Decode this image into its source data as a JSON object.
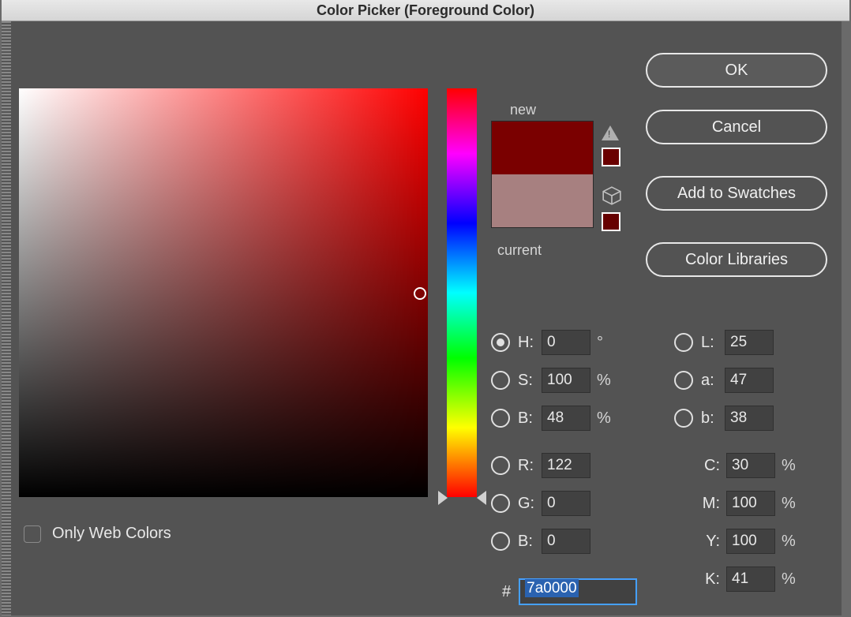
{
  "title": "Color Picker (Foreground Color)",
  "buttons": {
    "ok": "OK",
    "cancel": "Cancel",
    "add_swatches": "Add to Swatches",
    "color_libraries": "Color Libraries"
  },
  "preview": {
    "new_label": "new",
    "current_label": "current",
    "new_color": "#7a0000",
    "current_color": "#a78080",
    "warn_swatch": "#6a0000",
    "websafe_swatch": "#660000"
  },
  "only_web_colors": {
    "label": "Only Web Colors",
    "checked": false
  },
  "hsb": {
    "h": {
      "label": "H:",
      "value": "0",
      "unit": "°",
      "selected": true
    },
    "s": {
      "label": "S:",
      "value": "100",
      "unit": "%",
      "selected": false
    },
    "b": {
      "label": "B:",
      "value": "48",
      "unit": "%",
      "selected": false
    }
  },
  "rgb": {
    "r": {
      "label": "R:",
      "value": "122",
      "selected": false
    },
    "g": {
      "label": "G:",
      "value": "0",
      "selected": false
    },
    "b": {
      "label": "B:",
      "value": "0",
      "selected": false
    }
  },
  "lab": {
    "l": {
      "label": "L:",
      "value": "25",
      "selected": false
    },
    "a": {
      "label": "a:",
      "value": "47",
      "selected": false
    },
    "b": {
      "label": "b:",
      "value": "38",
      "selected": false
    }
  },
  "cmyk": {
    "c": {
      "label": "C:",
      "value": "30",
      "unit": "%"
    },
    "m": {
      "label": "M:",
      "value": "100",
      "unit": "%"
    },
    "y": {
      "label": "Y:",
      "value": "100",
      "unit": "%"
    },
    "k": {
      "label": "K:",
      "value": "41",
      "unit": "%"
    }
  },
  "hex": {
    "label": "#",
    "value": "7a0000"
  }
}
